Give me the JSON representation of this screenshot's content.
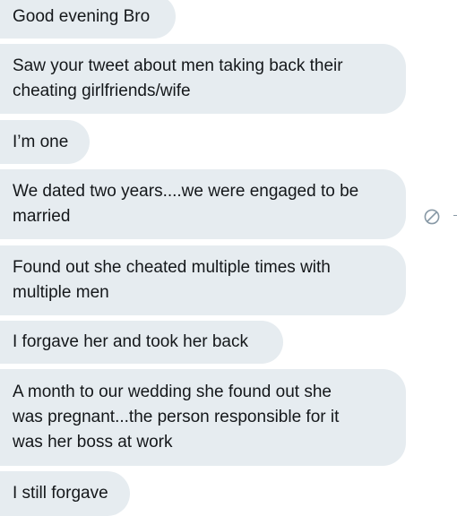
{
  "messages": [
    "Good evening Bro",
    "Saw your tweet about men taking back their\ncheating girlfriends/wife",
    "I’m one",
    "We dated two years....we were engaged to be\nmarried",
    "Found out she cheated multiple times with\nmultiple men",
    "I forgave her and took her back",
    "A month to our wedding she found out she\nwas pregnant...the person responsible for it\nwas her boss at work",
    "I still forgave"
  ],
  "icons": {
    "message_action": "block-icon"
  },
  "colors": {
    "bubble_background": "#e6ecf0",
    "text": "#14171a",
    "icon": "#8899a6",
    "page_background": "#ffffff"
  }
}
